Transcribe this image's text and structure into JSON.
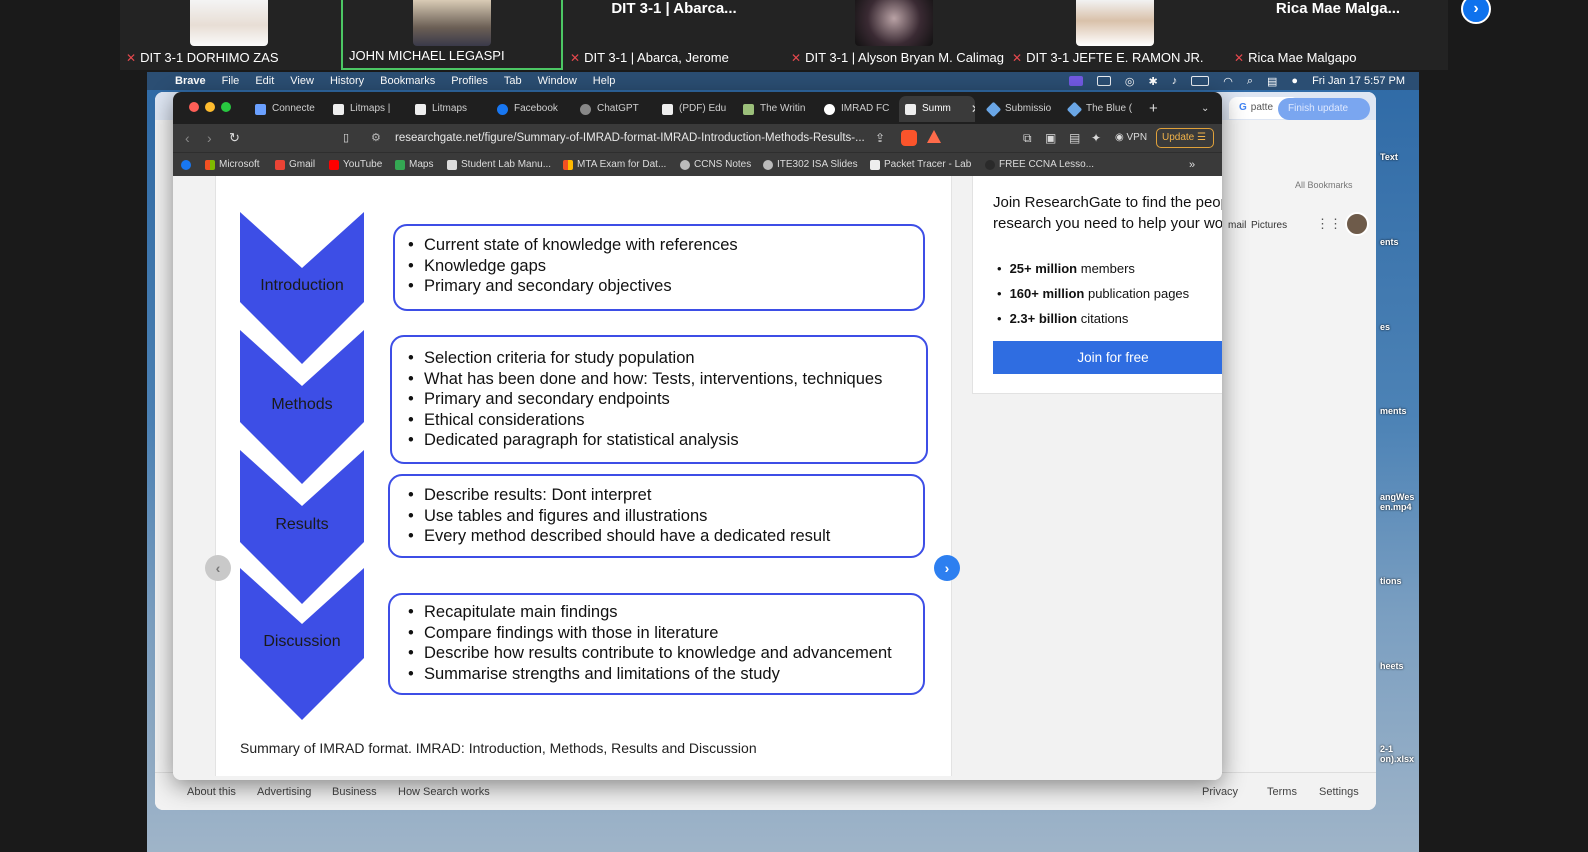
{
  "zoom": {
    "participants": [
      {
        "name": "DIT 3-1 DORHIMO ZAS",
        "muted": true
      },
      {
        "name": "JOHN MICHAEL LEGASPI",
        "muted": false
      },
      {
        "name": "DIT 3-1 | Abarca, Jerome",
        "display_title": "DIT 3-1 | Abarca...",
        "muted": true
      },
      {
        "name": "DIT 3-1 | Alyson Bryan M. Calimag",
        "muted": true
      },
      {
        "name": "DIT 3-1 JEFTE E. RAMON JR.",
        "muted": true
      },
      {
        "name": "Rica Mae Malgapo",
        "display_title": "Rica  Mae  Malga...",
        "muted": true
      }
    ],
    "next_icon": "chevron-right-icon",
    "colors": {
      "active_border": "#4cc764",
      "muted_icon": "#e5484d",
      "next_button": "#0e72ed"
    }
  },
  "mac_menubar": {
    "app": "Brave",
    "items": [
      "File",
      "Edit",
      "View",
      "History",
      "Bookmarks",
      "Profiles",
      "Tab",
      "Window",
      "Help"
    ],
    "clock": "Fri Jan 17  5:57 PM"
  },
  "browser": {
    "tabs": [
      {
        "label": "Connecte",
        "active": false
      },
      {
        "label": "Litmaps | ",
        "active": false
      },
      {
        "label": "Litmaps",
        "active": false
      },
      {
        "label": "Facebook",
        "active": false
      },
      {
        "label": "ChatGPT",
        "active": false
      },
      {
        "label": "(PDF) Edu",
        "active": false
      },
      {
        "label": "The Writin",
        "active": false
      },
      {
        "label": "IMRAD FC",
        "active": false
      },
      {
        "label": "Summ",
        "active": true
      },
      {
        "label": "Submissio",
        "active": false
      },
      {
        "label": "The Blue (",
        "active": false
      }
    ],
    "new_tab": "+",
    "url": "researchgate.net/figure/Summary-of-IMRAD-format-IMRAD-Introduction-Methods-Results-...",
    "vpn_label": "VPN",
    "update_label": "Update",
    "bookmarks": [
      "Microsoft",
      "Gmail",
      "YouTube",
      "Maps",
      "Student Lab Manu...",
      "MTA Exam for Dat...",
      "CCNS Notes",
      "ITE302 ISA Slides",
      "Packet Tracer - Lab",
      "FREE CCNA Lesso..."
    ],
    "more": "»"
  },
  "figure": {
    "sections": [
      {
        "label": "Introduction",
        "bullets": [
          "Current state of knowledge with references",
          "Knowledge gaps",
          "Primary and secondary objectives"
        ]
      },
      {
        "label": "Methods",
        "bullets": [
          "Selection criteria for study population",
          "What has been done and how: Tests, interventions, techniques",
          "Primary and secondary endpoints",
          "Ethical considerations",
          "Dedicated paragraph for statistical analysis"
        ]
      },
      {
        "label": "Results",
        "bullets": [
          "Describe results: Dont interpret",
          "Use tables and figures and illustrations",
          "Every method described should have a dedicated  result"
        ]
      },
      {
        "label": "Discussion",
        "bullets": [
          "Recapitulate main findings",
          "Compare findings with those in literature",
          "Describe how results contribute to knowledge and  advancement",
          "Summarise strengths and limitations of the study"
        ]
      }
    ],
    "caption": "Summary of IMRAD format. IMRAD: Introduction, Methods, Results and Discussion",
    "colors": {
      "chevron": "#3d4ee6",
      "box_border": "#3d4ee6",
      "next_button": "#2d7ff0"
    }
  },
  "join_panel": {
    "title": "Join ResearchGate to find the people and research you need to help your work",
    "stats": [
      {
        "value": "25+ million",
        "label": " members"
      },
      {
        "value": "160+ million",
        "label": " publication pages"
      },
      {
        "value": "2.3+ billion",
        "label": " citations"
      }
    ],
    "button": "Join for free",
    "colors": {
      "button": "#2f6de1"
    }
  },
  "back_window": {
    "tab_label": "patte",
    "finish_update": "Finish update",
    "all_bookmarks": "All Bookmarks",
    "gmail": "mail",
    "pictures": "Pictures",
    "footer_left": [
      "About this",
      "Advertising",
      "Business",
      "How Search works"
    ],
    "footer_right": [
      "Privacy",
      "Terms",
      "Settings"
    ]
  },
  "desktop_labels": [
    "Text",
    "ents",
    "es",
    "ments",
    "angWes en.mp4",
    "tions",
    "heets",
    "2-1 on).xlsx"
  ]
}
